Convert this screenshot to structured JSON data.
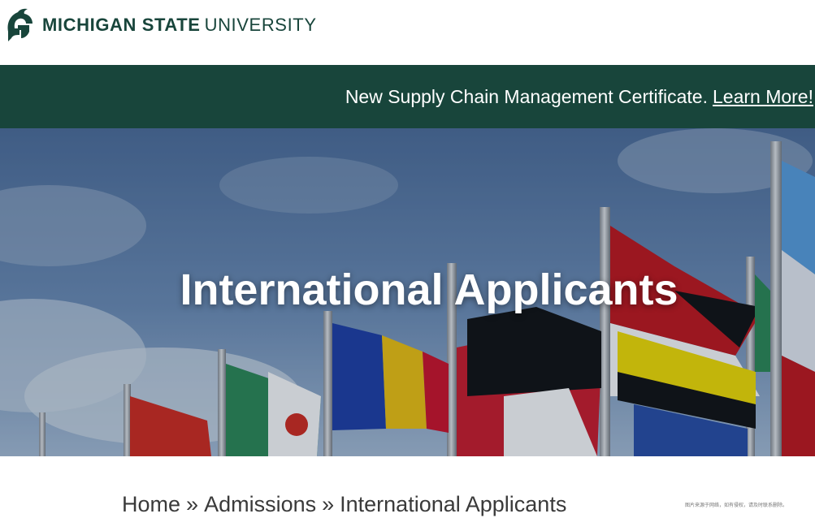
{
  "header": {
    "logo_bold": "MICHIGAN STATE",
    "logo_light": "UNIVERSITY",
    "logo_icon": "spartan-helmet-icon",
    "brand_color": "#18453b"
  },
  "announcement": {
    "text": "New Supply Chain Management Certificate.",
    "link_label": "Learn More!",
    "background": "#18453b"
  },
  "hero": {
    "title": "International Applicants",
    "image": "flags-on-flagpoles-photo"
  },
  "breadcrumb": {
    "items": [
      "Home",
      "Admissions"
    ],
    "separator": "»",
    "current": "International Applicants"
  },
  "watermark": "图片来源于网络，如有侵权，请及时联系删除。"
}
